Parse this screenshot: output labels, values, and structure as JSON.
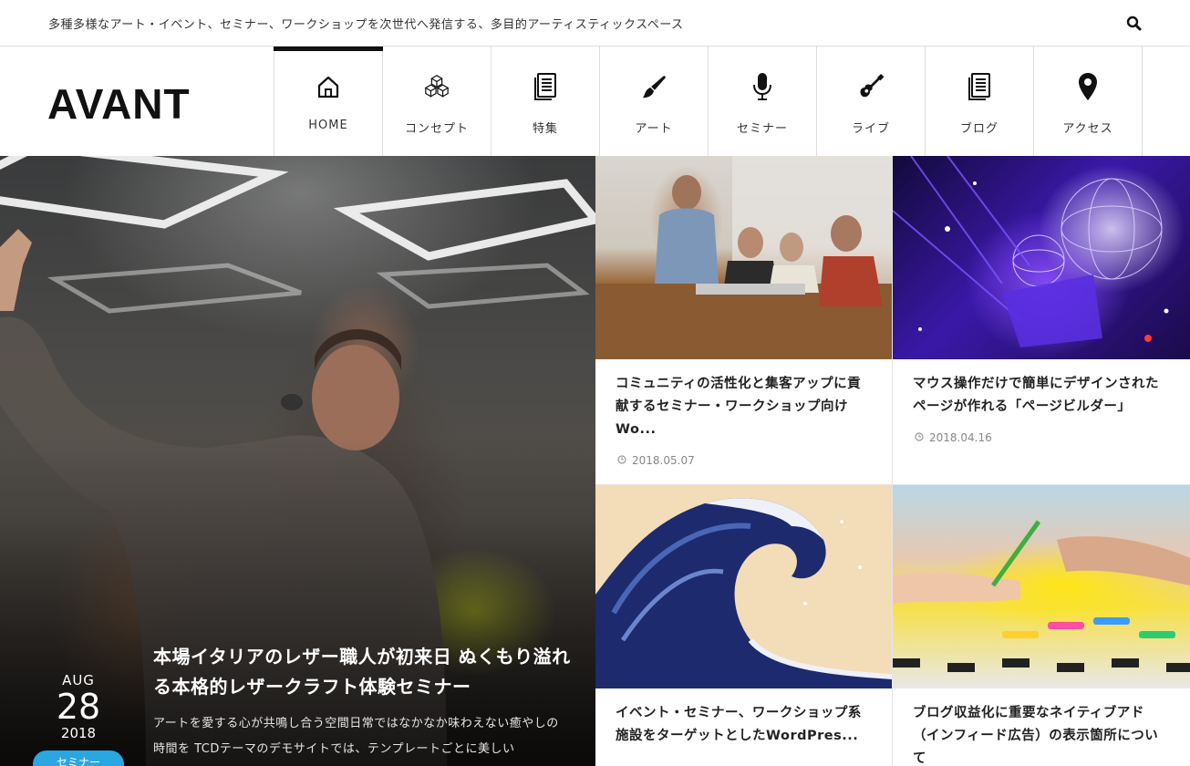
{
  "site": {
    "tagline": "多種多様なアート・イベント、セミナー、ワークショップを次世代へ発信する、多目的アーティスティックスペース",
    "logo": "AVANT"
  },
  "nav": {
    "items": [
      {
        "label": "HOME",
        "icon": "home-icon",
        "active": true
      },
      {
        "label": "コンセプト",
        "icon": "cubes-icon"
      },
      {
        "label": "特集",
        "icon": "document-icon"
      },
      {
        "label": "アート",
        "icon": "brush-icon"
      },
      {
        "label": "セミナー",
        "icon": "microphone-icon"
      },
      {
        "label": "ライブ",
        "icon": "guitar-icon"
      },
      {
        "label": "ブログ",
        "icon": "document-icon"
      },
      {
        "label": "アクセス",
        "icon": "map-pin-icon"
      }
    ]
  },
  "hero": {
    "month": "AUG",
    "day": "28",
    "year": "2018",
    "category": "セミナー",
    "title": "本場イタリアのレザー職人が初来日 ぬくもり溢れる本格的レザークラフト体験セミナー",
    "excerpt": "アートを愛する心が共鳴し合う空間日常ではなかなか味わえない癒やしの時間を TCDテーマのデモサイトでは、テンプレートごとに美しい"
  },
  "posts": [
    {
      "title": "コミュニティの活性化と集客アップに貢献するセミナー・ワークショップ向けWo...",
      "date": "2018.05.07"
    },
    {
      "title": "マウス操作だけで簡単にデザインされたページが作れる「ページビルダー」",
      "date": "2018.04.16"
    },
    {
      "title": "イベント・セミナー、ワークショップ系施設をターゲットとしたWordPres...",
      "date": ""
    },
    {
      "title": "ブログ収益化に重要なネイティブアド（インフィード広告）の表示箇所について",
      "date": ""
    }
  ],
  "colors": {
    "category_badge": "#2aa6e0",
    "active_nav_bar": "#111111"
  }
}
